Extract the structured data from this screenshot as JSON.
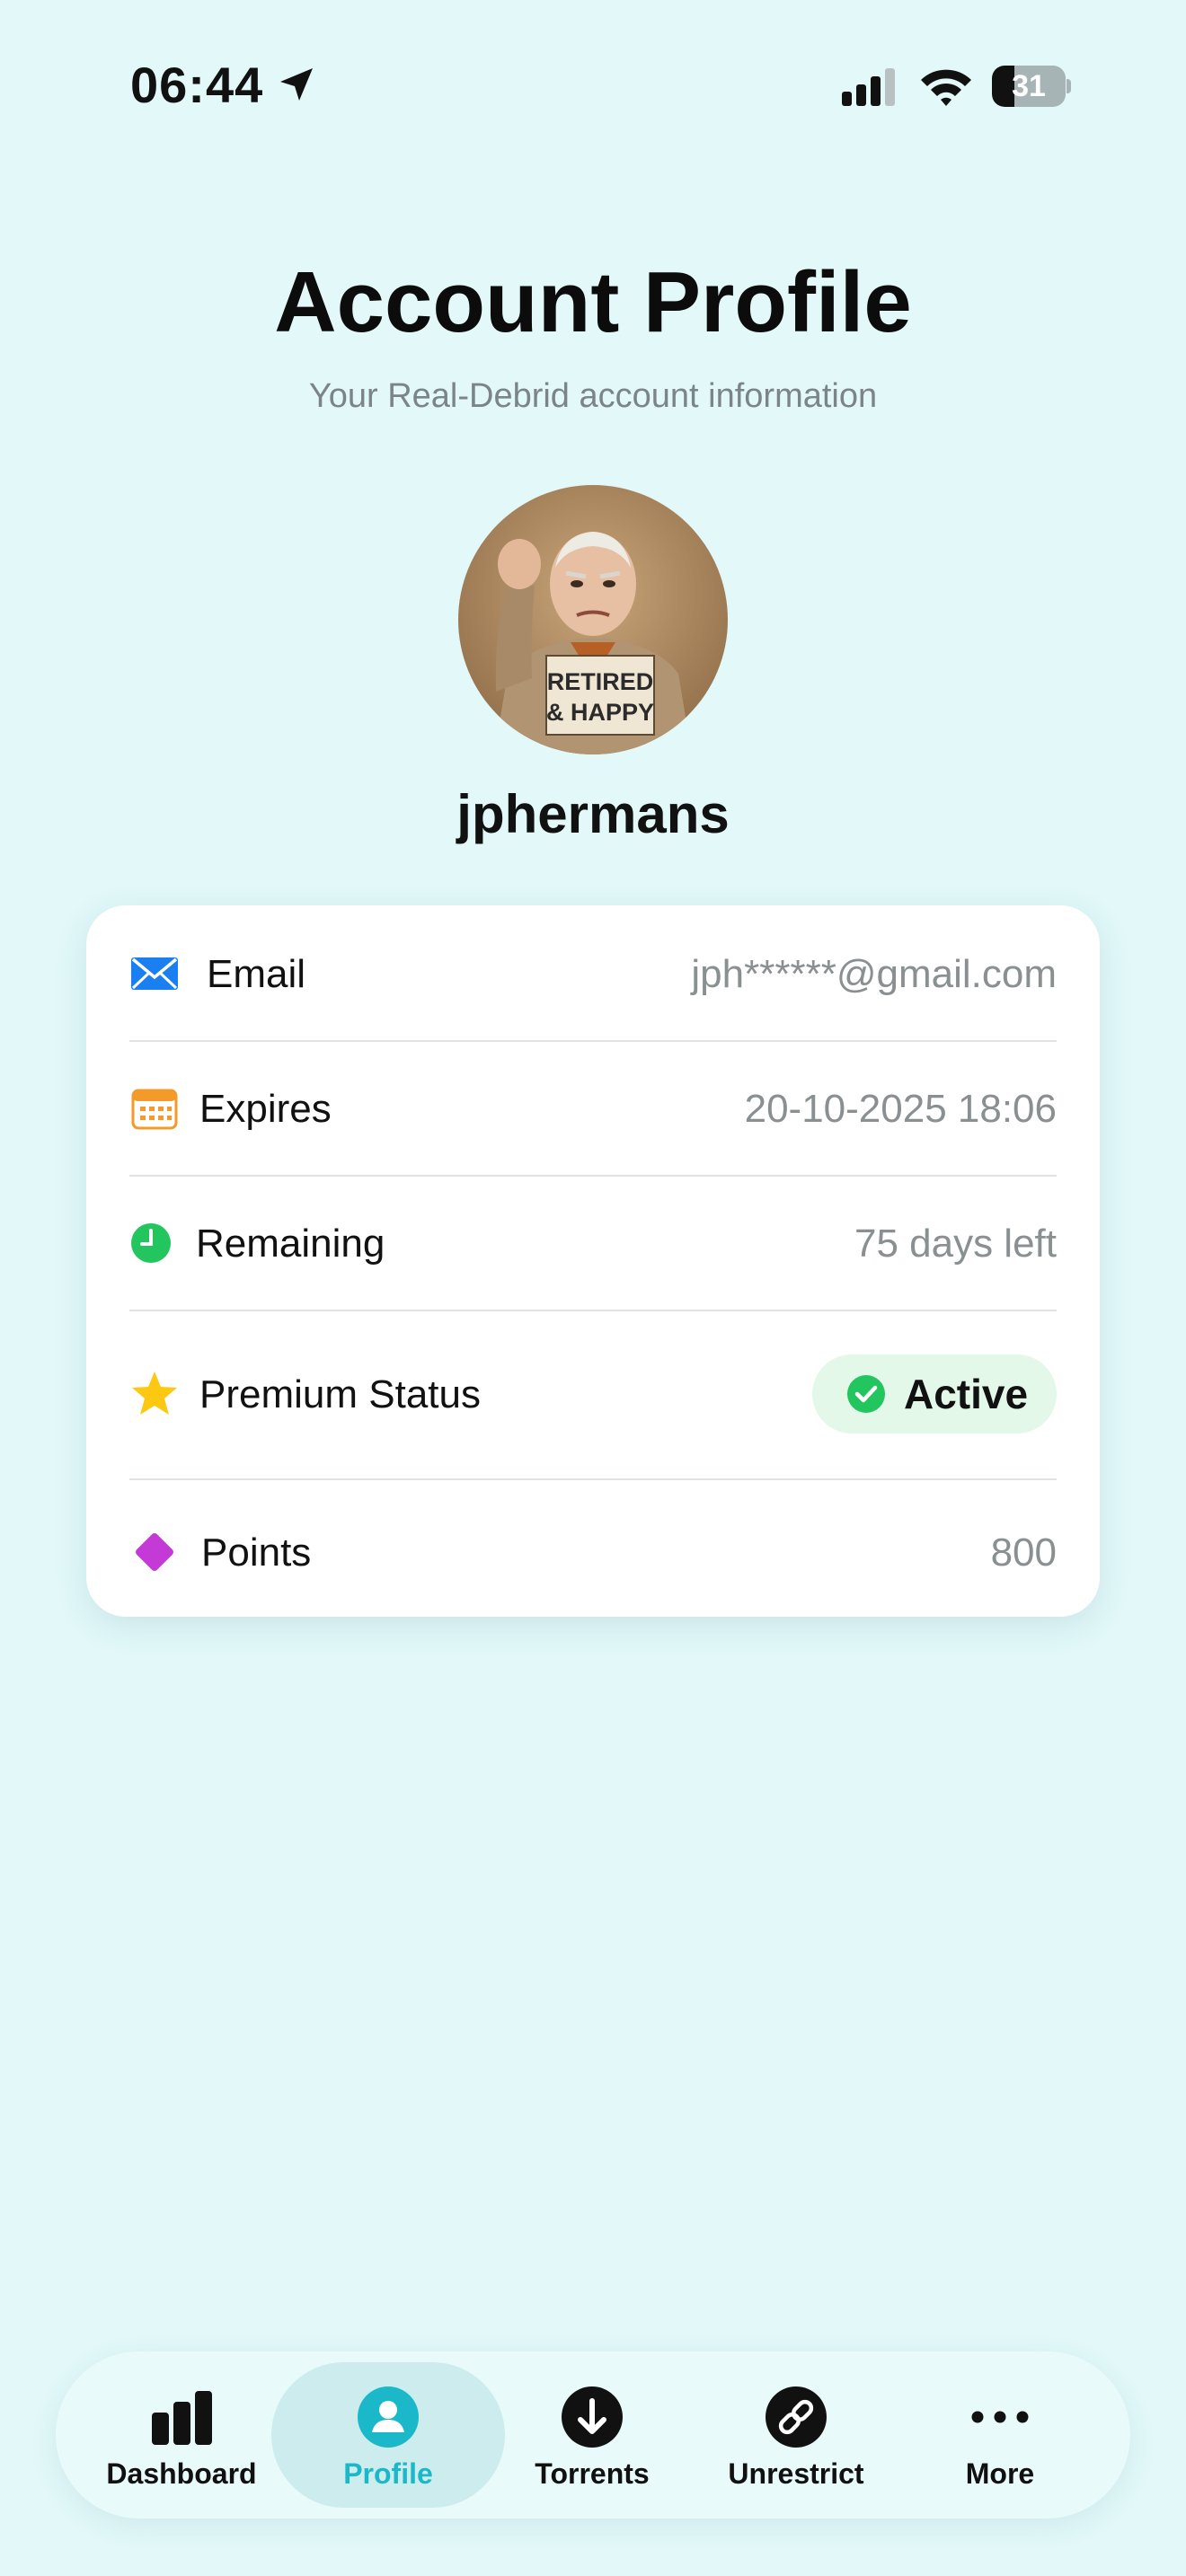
{
  "status_bar": {
    "time": "06:44",
    "battery_level": "31",
    "battery_fraction": 0.31
  },
  "header": {
    "title": "Account Profile",
    "subtitle": "Your Real-Debrid account information"
  },
  "profile": {
    "avatar_sign_line1": "RETIRED",
    "avatar_sign_line2": "& HAPPY",
    "username": "jphermans"
  },
  "info_rows": {
    "email": {
      "label": "Email",
      "value": "jph******@gmail.com",
      "icon": "envelope-icon"
    },
    "expires": {
      "label": "Expires",
      "value": "20-10-2025 18:06",
      "icon": "calendar-icon"
    },
    "remaining": {
      "label": "Remaining",
      "value": "75 days left",
      "icon": "clock-icon"
    },
    "premium_status": {
      "label": "Premium Status",
      "value": "Active",
      "icon": "star-icon"
    },
    "points": {
      "label": "Points",
      "value": "800",
      "icon": "diamond-icon"
    }
  },
  "colors": {
    "background": "#e2f8f9",
    "accent": "#1bb8c9",
    "email_icon": "#1a7ff0",
    "calendar_icon": "#f39a2a",
    "clock_icon": "#22c55e",
    "star_icon": "#fcc812",
    "diamond_icon": "#c33ad6",
    "active_pill_bg": "#e4f8ea",
    "active_check": "#22c55e"
  },
  "tab_bar": {
    "selected": "Profile",
    "tabs": [
      {
        "label": "Dashboard",
        "icon": "bar-chart-icon"
      },
      {
        "label": "Profile",
        "icon": "person-icon"
      },
      {
        "label": "Torrents",
        "icon": "download-arrow-icon"
      },
      {
        "label": "Unrestrict",
        "icon": "link-icon"
      },
      {
        "label": "More",
        "icon": "ellipsis-icon"
      }
    ]
  }
}
